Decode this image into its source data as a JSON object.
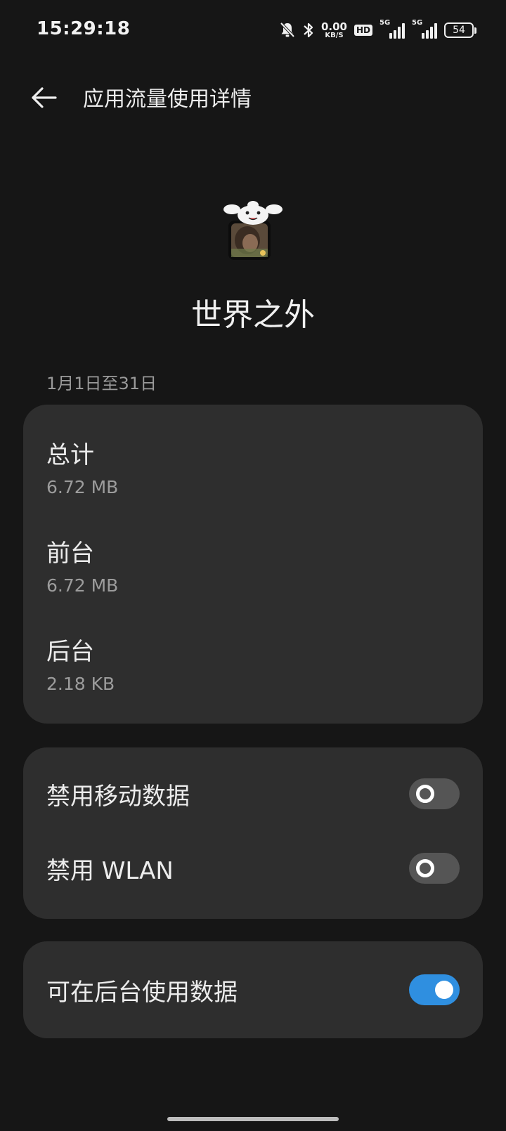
{
  "status_bar": {
    "time": "15:29:18",
    "icons": [
      "bell-off-icon",
      "bluetooth-icon",
      "hd-icon",
      "signal-5g-icon",
      "signal-5g-icon",
      "battery-icon"
    ],
    "net_speed_value": "0.00",
    "net_speed_unit": "KB/S",
    "hd_label": "HD",
    "signal1_label": "5G",
    "signal2_label": "5G",
    "battery_level": "54"
  },
  "header": {
    "back_icon": "arrow-left-icon",
    "title": "应用流量使用详情"
  },
  "app": {
    "name": "世界之外",
    "icon": "app-icon"
  },
  "period": {
    "label": "1月1日至31日"
  },
  "usage": {
    "total": {
      "label": "总计",
      "value": "6.72 MB"
    },
    "foreground": {
      "label": "前台",
      "value": "6.72 MB"
    },
    "background": {
      "label": "后台",
      "value": "2.18 KB"
    }
  },
  "restrictions": {
    "mobile_data": {
      "label": "禁用移动数据",
      "enabled": false
    },
    "wlan": {
      "label": "禁用 WLAN",
      "enabled": false
    }
  },
  "background_data": {
    "label": "可在后台使用数据",
    "enabled": true
  },
  "colors": {
    "background": "#161616",
    "card": "#2e2e2e",
    "toggle_on": "#2f8fe0",
    "toggle_off": "#555555"
  }
}
